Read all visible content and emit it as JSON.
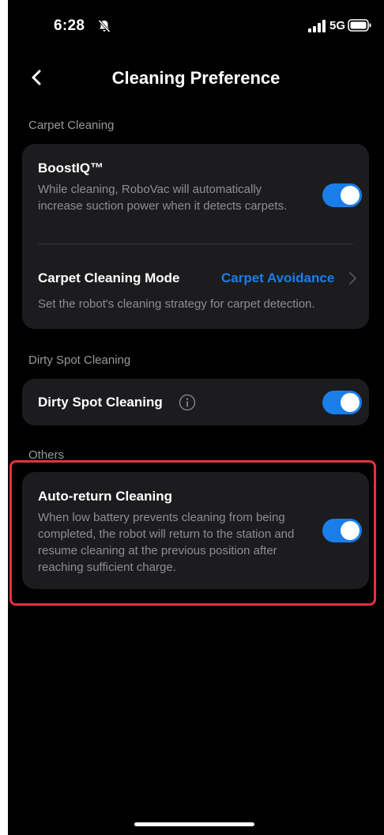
{
  "status_bar": {
    "time": "6:28",
    "network": "5G"
  },
  "nav": {
    "title": "Cleaning Preference"
  },
  "sections": {
    "carpet": {
      "header": "Carpet Cleaning",
      "boostiq": {
        "title": "BoostIQ™",
        "description": "While cleaning, RoboVac will automatically increase suction power when it detects carpets.",
        "enabled": true
      },
      "carpet_mode": {
        "title": "Carpet Cleaning Mode",
        "value": "Carpet Avoidance",
        "description": "Set the robot's cleaning strategy for carpet detection."
      }
    },
    "dirty_spot": {
      "header": "Dirty Spot Cleaning",
      "item": {
        "title": "Dirty Spot Cleaning",
        "enabled": true
      }
    },
    "others": {
      "header": "Others",
      "auto_return": {
        "title": "Auto-return Cleaning",
        "description": "When low battery prevents cleaning from being completed, the robot will return to the station and resume cleaning at the previous position after reaching sufficient charge.",
        "enabled": true
      }
    }
  },
  "colors": {
    "accent": "#1a7ee8",
    "card": "#1c1c1e",
    "background": "#000000",
    "highlight": "#e0343f",
    "secondary_text": "#8e8e93"
  },
  "icons": [
    "bell-slash-icon",
    "signal-icon",
    "battery-icon",
    "chevron-left-icon",
    "chevron-right-icon",
    "info-icon"
  ]
}
